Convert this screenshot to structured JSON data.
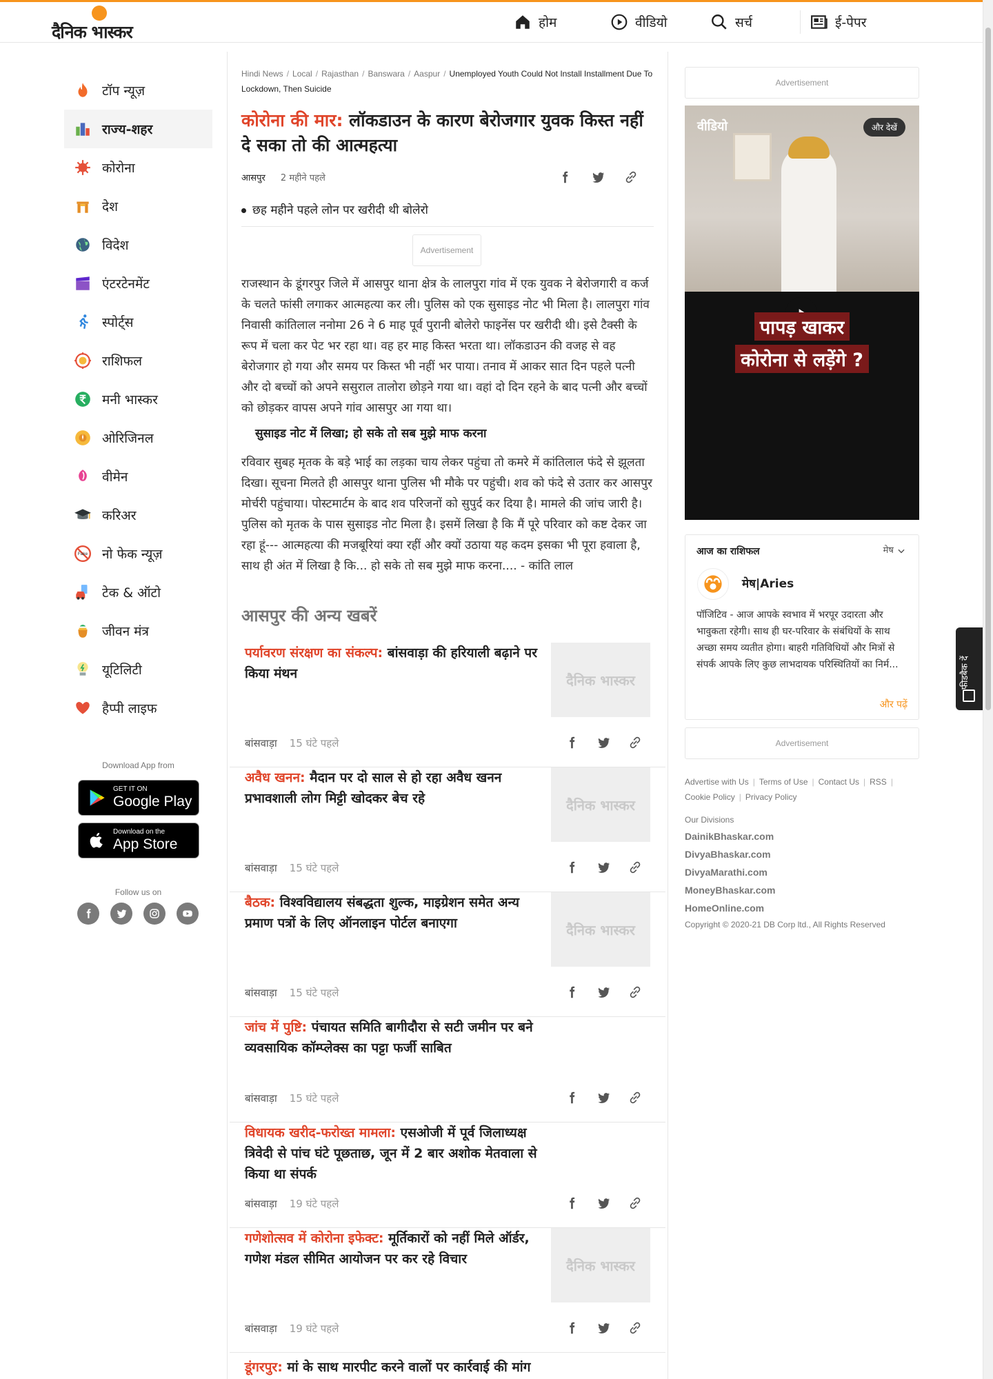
{
  "header": {
    "logo_text": "दैनिक भास्कर",
    "nav": {
      "home": "होम",
      "video": "वीडियो",
      "search": "सर्च",
      "epaper": "ई-पेपर"
    }
  },
  "sidebar": {
    "items": [
      {
        "label": "टॉप न्यूज़",
        "icon": "fire-icon"
      },
      {
        "label": "राज्य-शहर",
        "icon": "city-icon"
      },
      {
        "label": "कोरोना",
        "icon": "virus-icon"
      },
      {
        "label": "देश",
        "icon": "india-gate-icon"
      },
      {
        "label": "विदेश",
        "icon": "globe-icon"
      },
      {
        "label": "एंटरटेनमेंट",
        "icon": "clapper-icon"
      },
      {
        "label": "स्पोर्ट्स",
        "icon": "runner-icon"
      },
      {
        "label": "राशिफल",
        "icon": "zodiac-icon"
      },
      {
        "label": "मनी भास्कर",
        "icon": "rupee-icon"
      },
      {
        "label": "ओरिजिनल",
        "icon": "original-icon"
      },
      {
        "label": "वीमेन",
        "icon": "women-icon"
      },
      {
        "label": "करिअर",
        "icon": "graduation-cap-icon"
      },
      {
        "label": "नो फेक न्यूज़",
        "icon": "no-fake-icon"
      },
      {
        "label": "टेक & ऑटो",
        "icon": "car-icon"
      },
      {
        "label": "जीवन मंत्र",
        "icon": "kalash-icon"
      },
      {
        "label": "यूटिलिटी",
        "icon": "bulb-icon"
      },
      {
        "label": "हैप्पी लाइफ",
        "icon": "heart-hand-icon"
      }
    ],
    "active_index": 1,
    "download_label": "Download App from",
    "google_play": {
      "small": "GET IT ON",
      "big": "Google Play"
    },
    "app_store": {
      "small": "Download on the",
      "big": "App Store"
    },
    "follow_label": "Follow us on"
  },
  "breadcrumb": {
    "items": [
      "Hindi News",
      "Local",
      "Rajasthan",
      "Banswara",
      "Aaspur"
    ],
    "current": "Unemployed Youth Could Not Install Installment Due To Lockdown, Then Suicide"
  },
  "article": {
    "kicker": "कोरोना की मार:",
    "title": " लॉकडाउन के कारण बेरोजगार युवक किस्त नहीं दे सका तो की आत्महत्या",
    "location": "आसपुर",
    "time": "2 महीने पहले",
    "bullet": "छह महीने पहले लोन पर खरीदी थी बोलेरो",
    "ad_label": "Advertisement",
    "para1": "राजस्थान के डूंगरपुर जिले में आसपुर थाना क्षेत्र के लालपुरा गांव में एक युवक ने बेरोजगारी व कर्ज के चलते फांसी लगाकर आत्महत्या कर ली। पुलिस को एक  सुसाइड नोट भी मिला है। लालपुरा गांव निवासी कांतिलाल ननोमा 26 ने 6 माह पूर्व पुरानी बोलेरो फाइनेंस पर खरीदी थी। इसे टैक्सी के रूप में चला कर पेट भर रहा था। वह हर माह किस्त भरता था। लॉकडाउन की वजह से वह बेरोजगार हो गया और समय पर किस्त भी नहीं भर पाया। तनाव में आकर सात दिन पहले पत्नी और दो बच्चों को अपने ससुराल तालोरा छोड़ने गया था। वहां दो दिन रहने के बाद पत्नी और बच्चों को छोड़कर वापस अपने गांव आसपुर आ गया था।",
    "subhead": "सुसाइड नोट में लिखा; हो सके तो सब मुझे माफ करना",
    "para2": "रविवार सुबह मृतक के बड़े भाई का लड़का चाय लेकर पहुंचा तो कमरे में कांतिलाल फंदे से झूलता दिखा। सूचना मिलते ही आसपुर थाना पुलिस भी मौके पर पहुंची। शव को फंदे से उतार कर आसपुर मोर्चरी पहुंचाया। पोस्टमार्टम के बाद शव परिजनों को सुपुर्द कर दिया है। मामले की जांच जारी है। पुलिस को मृतक के पास सुसाइड नोट मिला है। इसमें लिखा है कि मैं पूरे परिवार को कष्ट देकर जा रहा हूं--- आत्महत्या की मजबूरियां क्या रहीं और क्यों उठाया यह कदम इसका भी पूरा हवाला है, साथ ही अंत में लिखा है कि... हो सके तो सब मुझे माफ करना.... - कांति लाल"
  },
  "related": {
    "title": "आसपुर की अन्य खबरें",
    "thumb_text": "दैनिक भास्कर",
    "stories": [
      {
        "kicker": "पर्यावरण संरक्षण का संकल्प:",
        "title": " बांसवाड़ा की हरियाली बढ़ाने पर किया मंथन",
        "place": "बांसवाड़ा",
        "time": "15 घंटे पहले"
      },
      {
        "kicker": "अवैध खनन:",
        "title": " मैदान पर दो साल से हो रहा अवैध खनन प्रभावशाली लोग मिट्टी खोदकर बेच रहे",
        "place": "बांसवाड़ा",
        "time": "15 घंटे पहले"
      },
      {
        "kicker": "बैठक:",
        "title": " विश्वविद्यालय संबद्धता शुल्क, माइग्रेशन समेत अन्य प्रमाण पत्रों के लिए ऑनलाइन पोर्टल बनाएगा",
        "place": "बांसवाड़ा",
        "time": "15 घंटे पहले"
      },
      {
        "kicker": "जांच में पुष्टि:",
        "title": " पंचायत समिति बागीदौरा से सटी जमीन पर बने व्यवसायिक कॉम्प्लेक्स का पट्टा फर्जी साबित",
        "place": "बांसवाड़ा",
        "time": "15 घंटे पहले"
      },
      {
        "kicker": "विधायक खरीद-फरोख्त मामला:",
        "title": " एसओजी में पूर्व जिलाध्यक्ष त्रिवेदी से पांच घंटे पूछताछ, जून में 2 बार अशोक मेतवाला से किया था संपर्क",
        "place": "बांसवाड़ा",
        "time": "19 घंटे पहले"
      },
      {
        "kicker": "गणेशोत्सव में कोरोना इफेक्ट:",
        "title": " मूर्तिकारों को नहीं मिले ऑर्डर, गणेश मंडल सीमित आयोजन पर कर रहे विचार",
        "place": "बांसवाड़ा",
        "time": "19 घंटे पहले"
      },
      {
        "kicker": "डूंगरपुर:",
        "title": " मां के साथ मारपीट करने वालों पर कार्रवाई की मांग",
        "place": "",
        "time": ""
      }
    ]
  },
  "right": {
    "ad_label": "Advertisement",
    "video": {
      "label": "वीडियो",
      "more": "और देखें",
      "caption_line1": "पापड़ खाकर",
      "caption_line2": "कोरोना से लड़ेंगे ?"
    },
    "rashifal": {
      "heading": "आज का राशिफल",
      "select": "मेष",
      "name": "मेष|Aries",
      "text": "पॉजिटिव - आज आपके स्वभाव में भरपूर उदारता और भावुकता रहेगी। साथ ही घर-परिवार के संबंधियों के साथ अच्छा समय व्यतीत होगा। बाहरी गतिविधियों और मित्रों से संपर्क आपके लिए कुछ लाभदायक परिस्थितियों का निर्म...",
      "more": "और पढ़ें"
    },
    "footer_links": [
      "Advertise with Us",
      "Terms of Use",
      "Contact Us",
      "RSS",
      "Cookie Policy",
      "Privacy Policy"
    ],
    "divisions_label": "Our Divisions",
    "divisions": [
      "DainikBhaskar.com",
      "DivyaBhaskar.com",
      "DivyaMarathi.com",
      "MoneyBhaskar.com",
      "HomeOnline.com"
    ],
    "copyright": "Copyright © 2020-21 DB Corp ltd., All Rights Reserved"
  },
  "feedback": {
    "label": "फीडबैक दें"
  },
  "colors": {
    "accent": "#f7941d",
    "kicker": "#e0452a"
  }
}
